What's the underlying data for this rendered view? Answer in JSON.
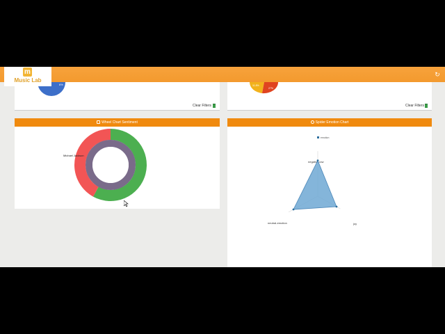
{
  "app": {
    "logo_letter": "m",
    "logo_text": "Music Lab",
    "refresh_icon": "refresh-icon",
    "accent": "#f39a2e"
  },
  "top_panels": {
    "left_clear_filters": "Clear Filters",
    "right_clear_filters": "Clear Filters",
    "left_pie_label": "6%",
    "right_pie_label_a": "11.8%",
    "right_pie_label_b": "27%"
  },
  "wheel_panel": {
    "title": "Wheel Chart Sentiment",
    "icon": "wheel-icon",
    "segment_label": "Michael Jackson"
  },
  "spider_panel": {
    "title": "Spider Emotion Chart",
    "icon": "user-icon",
    "legend": "emotion",
    "axis_top": "negative-low",
    "axis_right": "joy",
    "axis_left": "neutral-emotion",
    "color": "#6fa8d4"
  },
  "chart_data": [
    {
      "type": "pie",
      "title": "Wheel Chart Sentiment",
      "rings": [
        {
          "ring": "outer",
          "slices": [
            {
              "label": "",
              "value": 0.58,
              "color": "#4caf50"
            },
            {
              "label": "",
              "value": 0.42,
              "color": "#f25555"
            }
          ]
        },
        {
          "ring": "inner",
          "slices": [
            {
              "label": "Michael Jackson",
              "value": 1.0,
              "color": "#7a6b8a"
            }
          ]
        }
      ]
    },
    {
      "type": "radar",
      "title": "Spider Emotion Chart",
      "axes": [
        "negative-low",
        "joy",
        "neutral-emotion"
      ],
      "series": [
        {
          "name": "emotion",
          "values": [
            0.95,
            1.0,
            1.0
          ]
        }
      ]
    }
  ]
}
